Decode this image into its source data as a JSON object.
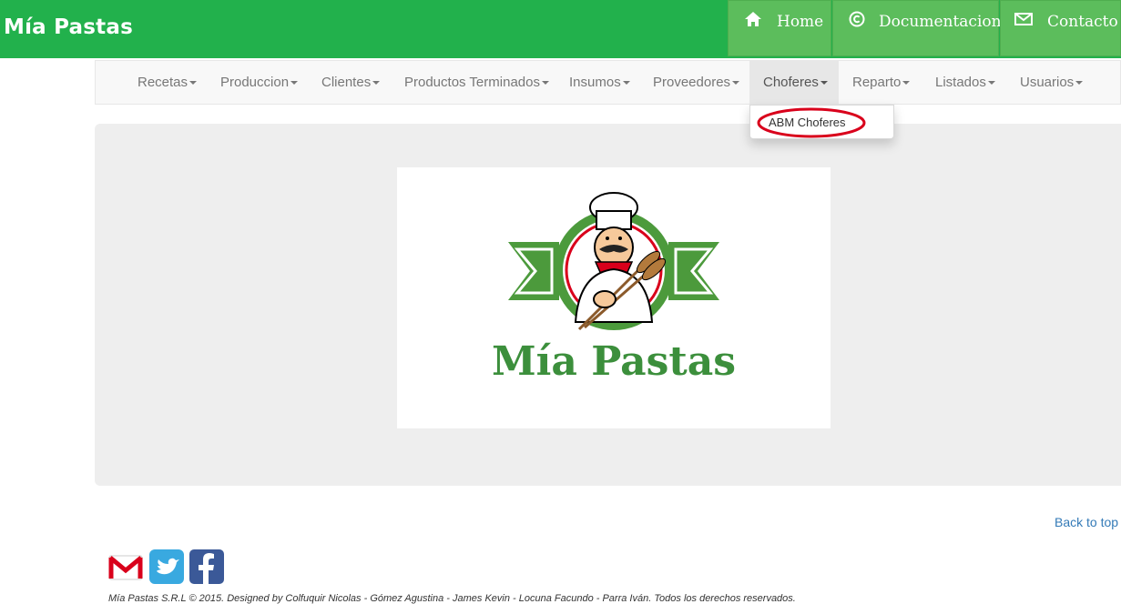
{
  "header": {
    "brand": "Mía Pastas",
    "nav": [
      {
        "label": "Home",
        "icon": "home-icon"
      },
      {
        "label": "Documentacion",
        "icon": "copyright-icon"
      },
      {
        "label": "Contacto",
        "icon": "envelope-icon"
      }
    ]
  },
  "menu": {
    "items": [
      "Recetas",
      "Produccion",
      "Clientes",
      "Productos Terminados",
      "Insumos",
      "Proveedores",
      "Choferes",
      "Reparto",
      "Listados",
      "Usuarios"
    ],
    "active": "Choferes",
    "dropdown": {
      "label": "ABM Choferes"
    }
  },
  "jumbotron": {
    "logo_text": "Mía Pastas"
  },
  "footer": {
    "back_to_top": "Back to top",
    "social": [
      "gmail-icon",
      "twitter-icon",
      "facebook-icon"
    ],
    "copyright": "Mía Pastas S.R.L © 2015. Designed by Colfuquir Nicolas - Gómez Agustina - James Kevin - Locuna Facundo - Parra Iván. Todos los derechos reservados."
  },
  "colors": {
    "header_green": "#22b14c",
    "button_green": "#5cbd5c",
    "logo_green": "#3c8f3c",
    "highlight_red": "#d9001b",
    "link_blue": "#337ab7"
  }
}
